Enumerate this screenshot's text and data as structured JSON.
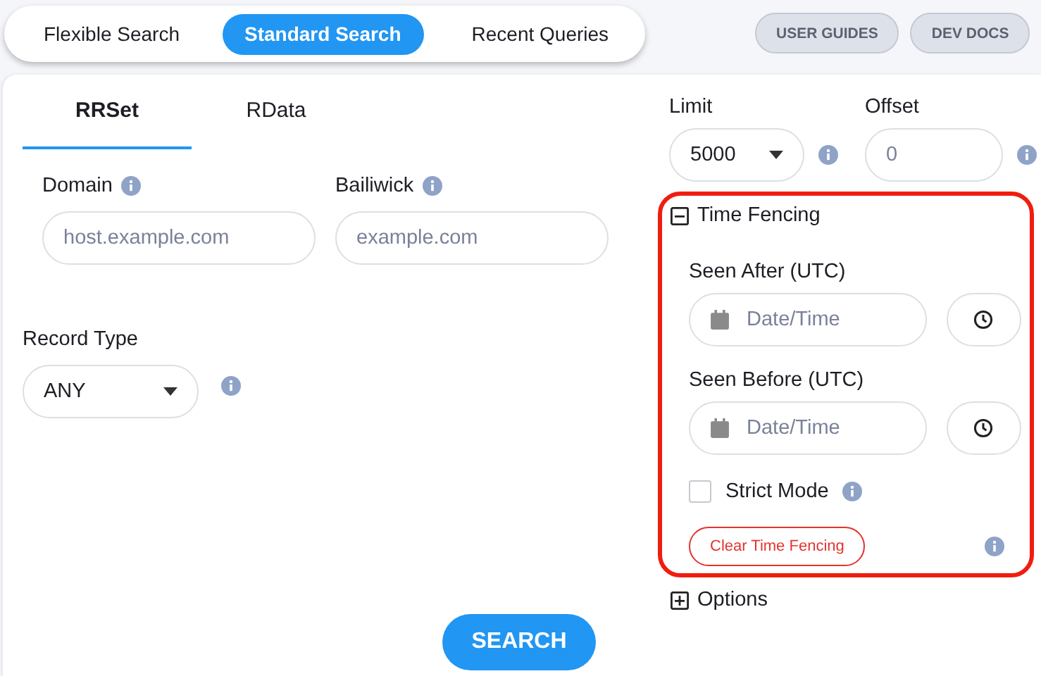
{
  "search_modes": [
    {
      "label": "Flexible Search",
      "selected": false
    },
    {
      "label": "Standard Search",
      "selected": true
    },
    {
      "label": "Recent Queries",
      "selected": false
    }
  ],
  "header_buttons": [
    "USER GUIDES",
    "DEV DOCS"
  ],
  "query_tabs": [
    {
      "label": "RRSet",
      "selected": true
    },
    {
      "label": "RData",
      "selected": false
    }
  ],
  "domain": {
    "label": "Domain",
    "placeholder": "host.example.com"
  },
  "bailiwick": {
    "label": "Bailiwick",
    "placeholder": "example.com"
  },
  "record_type": {
    "label": "Record Type",
    "value": "ANY"
  },
  "limit": {
    "label": "Limit",
    "value": "5000"
  },
  "offset": {
    "label": "Offset",
    "placeholder": "0"
  },
  "time_fencing": {
    "label": "Time Fencing",
    "expanded": true,
    "seen_after": {
      "label": "Seen After (UTC)",
      "placeholder": "Date/Time"
    },
    "seen_before": {
      "label": "Seen Before (UTC)",
      "placeholder": "Date/Time"
    },
    "strict_mode": {
      "label": "Strict Mode",
      "checked": false
    },
    "clear_button": "Clear Time Fencing"
  },
  "options": {
    "label": "Options",
    "expanded": false
  },
  "search_button": "SEARCH"
}
